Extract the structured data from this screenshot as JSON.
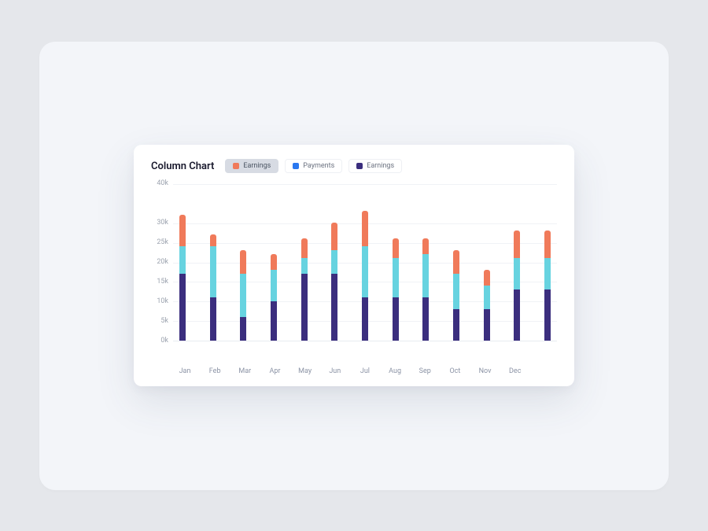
{
  "title": "Column Chart",
  "legend": [
    {
      "label": "Earnings",
      "color": "#f07a5a",
      "active": true
    },
    {
      "label": "Payments",
      "color": "#2a78f0",
      "active": false
    },
    {
      "label": "Earnings",
      "color": "#3b2e7e",
      "active": false
    }
  ],
  "y_ticks": [
    "40k",
    "30k",
    "25k",
    "20k",
    "15k",
    "10k",
    "5k",
    "0k"
  ],
  "chart_data": {
    "type": "bar",
    "stacked": true,
    "categories": [
      "Jan",
      "Feb",
      "Mar",
      "Apr",
      "May",
      "Jun",
      "Jul",
      "Aug",
      "Sep",
      "Oct",
      "Nov",
      "Dec",
      ""
    ],
    "series": [
      {
        "name": "Earnings",
        "color": "#3b2e7e",
        "values": [
          17,
          11,
          6,
          10,
          17,
          17,
          11,
          11,
          11,
          8,
          8,
          13,
          13
        ]
      },
      {
        "name": "Payments",
        "color": "#67d3e0",
        "values": [
          7,
          13,
          11,
          8,
          4,
          6,
          13,
          10,
          11,
          9,
          6,
          8,
          8
        ]
      },
      {
        "name": "Earnings",
        "color": "#f07a5a",
        "values": [
          8,
          3,
          6,
          4,
          5,
          7,
          9,
          5,
          4,
          6,
          4,
          7,
          7
        ]
      }
    ],
    "title": "Column Chart",
    "ylabel": "",
    "xlabel": "",
    "ylim": [
      0,
      40
    ]
  }
}
